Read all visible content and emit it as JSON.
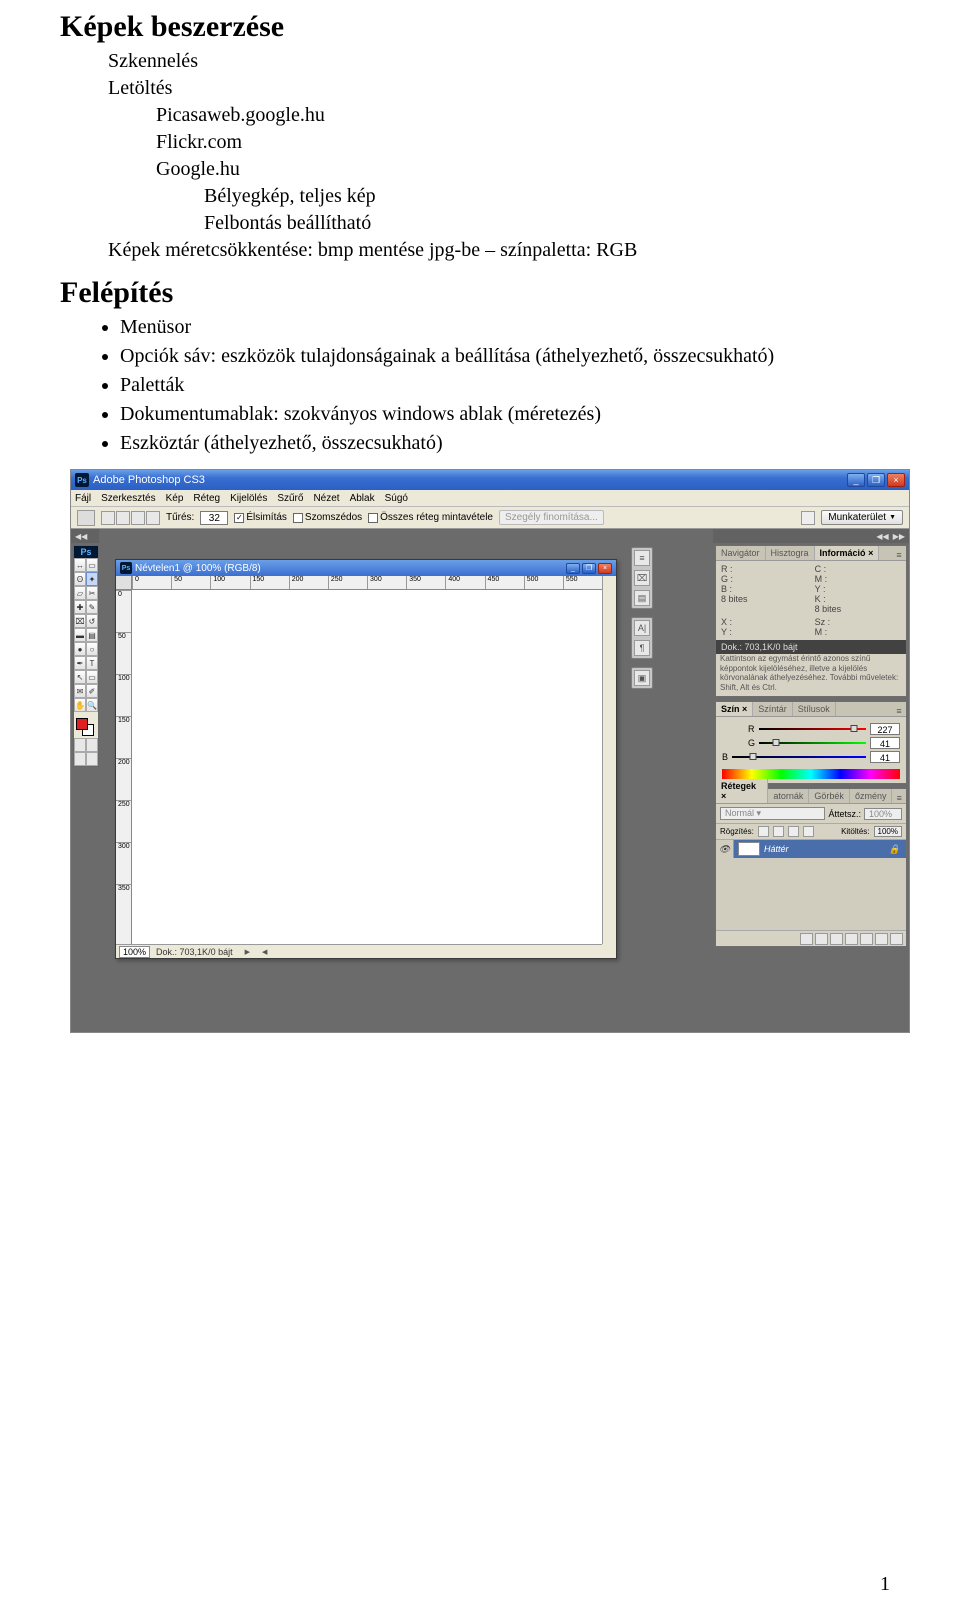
{
  "doc": {
    "h1": "Képek beszerzése",
    "items1": [
      "Szkennelés",
      "Letöltés"
    ],
    "items2": [
      "Picasaweb.google.hu",
      "Flickr.com",
      "Google.hu"
    ],
    "items3": [
      "Bélyegkép, teljes kép",
      "Felbontás beállítható"
    ],
    "line_after": "Képek méretcsökkentése: bmp mentése jpg-be – színpaletta: RGB",
    "h2": "Felépítés",
    "bullets": [
      "Menüsor",
      "Opciók sáv: eszközök tulajdonságainak a beállítása (áthelyezhető, összecsukható)",
      "Paletták",
      "Dokumentumablak: szokványos windows ablak (méretezés)",
      "Eszköztár (áthelyezhető, összecsukható)"
    ],
    "pagenum": "1"
  },
  "ps": {
    "title": "Adobe Photoshop CS3",
    "menus": [
      "Fájl",
      "Szerkesztés",
      "Kép",
      "Réteg",
      "Kijelölés",
      "Szűrő",
      "Nézet",
      "Ablak",
      "Súgó"
    ],
    "options": {
      "tolerance_label": "Tűrés:",
      "tolerance_value": "32",
      "antialias": "Élsimítás",
      "contiguous": "Szomszédos",
      "all_layers": "Összes réteg mintavétele",
      "refine": "Szegély finomítása...",
      "workspace": "Munkaterület"
    },
    "docwin": {
      "title": "Névtelen1 @ 100% (RGB/8)",
      "zoom": "100%",
      "info": "Dok.: 703,1K/0 bájt",
      "ruler_h": [
        "0",
        "50",
        "100",
        "150",
        "200",
        "250",
        "300",
        "350",
        "400",
        "450",
        "500",
        "550"
      ],
      "ruler_v": [
        "0",
        "50",
        "100",
        "150",
        "200",
        "250",
        "300",
        "350"
      ]
    },
    "info_panel": {
      "tabs": [
        "Navigátor",
        "Hisztogra",
        "Információ"
      ],
      "r": "R :",
      "g": "G :",
      "b": "B :",
      "c": "C :",
      "m": "M :",
      "y": "Y :",
      "k": "K :",
      "bits": "8 bites",
      "x": "X :",
      "yv": "Y :",
      "sx": "Sz :",
      "sy": "M :",
      "dok": "Dok.: 703,1K/0 bájt",
      "hint": "Kattintson az egymást érintő azonos színű képpontok kijelöléséhez, illetve a kijelölés körvonalának áthelyezéséhez. További műveletek: Shift, Alt és Ctrl."
    },
    "color_panel": {
      "tabs": [
        "Szín",
        "Színtár",
        "Stílusok"
      ],
      "r": "R",
      "g": "G",
      "b": "B",
      "rv": "227",
      "gv": "41",
      "bv": "41"
    },
    "layers_panel": {
      "tabs": [
        "Rétegek",
        "atornák",
        "Görbék",
        "őzmény"
      ],
      "mode": "Normál",
      "opacity_lbl": "Áttetsz.:",
      "opacity": "100%",
      "lock_lbl": "Rögzítés:",
      "fill_lbl": "Kitöltés:",
      "fill": "100%",
      "layer_name": "Háttér"
    }
  }
}
